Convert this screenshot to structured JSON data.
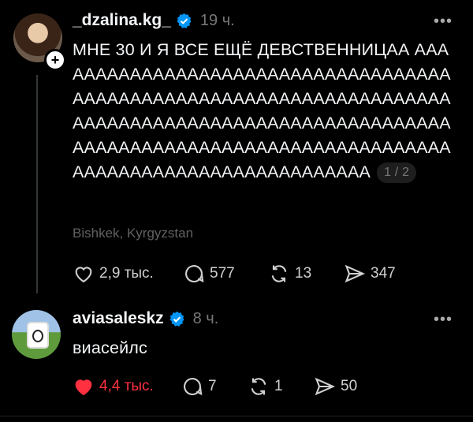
{
  "post1": {
    "username": "_dzalina.kg_",
    "time": "19 ч.",
    "text": "МНЕ 30 И Я ВСЕ ЕЩЁ ДЕВСТВЕННИЦАА ААААААААААААААААААААААААААААААААААААААААААААААААААААААААААААААААААААААААААААААААААААААААААААААААААААААААААААААААААААААААААААААААААААААААААААААААААААААААААААААААА",
    "page_indicator": "1 / 2",
    "location": "Bishkek, Kyrgyzstan",
    "likes": "2,9 тыс.",
    "comments": "577",
    "reposts": "13",
    "shares": "347"
  },
  "post2": {
    "username": "aviasaleskz",
    "time": "8 ч.",
    "text": "виасейлс",
    "likes": "4,4 тыс.",
    "comments": "7",
    "reposts": "1",
    "shares": "50",
    "like_color": "#ff3040"
  },
  "icons": {
    "verified": "verified-badge-icon",
    "like": "heart-icon",
    "comment": "comment-bubble-icon",
    "repost": "repost-arrows-icon",
    "share": "paper-plane-icon",
    "more": "more-dots-icon",
    "follow": "plus-icon"
  }
}
